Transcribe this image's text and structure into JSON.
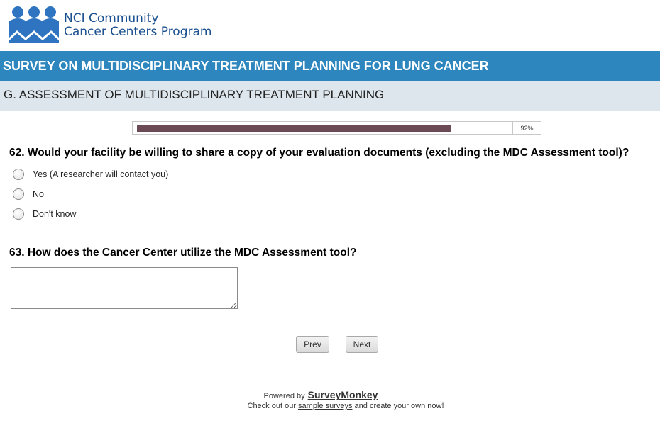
{
  "logo": {
    "line1": "NCI Community",
    "line2": "Cancer Centers Program"
  },
  "survey_title": "SURVEY ON MULTIDISCIPLINARY TREATMENT PLANNING FOR LUNG CANCER",
  "section_title": "G. ASSESSMENT OF MULTIDISCIPLINARY TREATMENT PLANNING",
  "progress": {
    "percent": 92,
    "label": "92%"
  },
  "q62": {
    "text": "62. Would your facility be willing to share a copy of your evaluation documents (excluding the MDC Assessment tool)?",
    "options": [
      "Yes (A researcher will contact you)",
      "No",
      "Don't know"
    ]
  },
  "q63": {
    "text": "63. How does the Cancer Center utilize the MDC Assessment tool?",
    "value": ""
  },
  "nav": {
    "prev": "Prev",
    "next": "Next"
  },
  "footer": {
    "powered_by": "Powered by",
    "brand": "SurveyMonkey",
    "check_out": "Check out our",
    "sample_link": "sample surveys",
    "create": "and create your own now!"
  },
  "colors": {
    "banner": "#2d86bd",
    "section": "#dde6ec",
    "progress_fill": "#6b4a55",
    "logo": "#1a4f8f"
  }
}
